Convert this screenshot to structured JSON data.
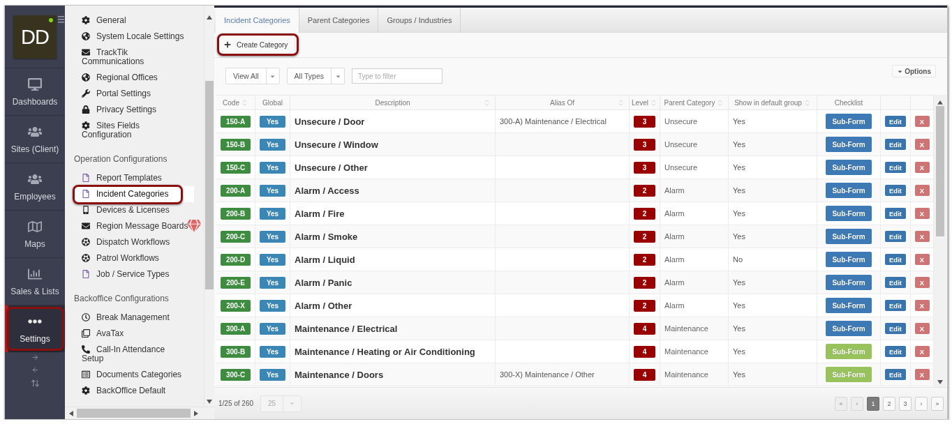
{
  "sidebar": {
    "avatar": {
      "initials": "DD",
      "online": true
    },
    "items": [
      {
        "label": "Dashboards",
        "selected": false,
        "highlighted": false
      },
      {
        "label": "Sites (Client)",
        "selected": false,
        "highlighted": false
      },
      {
        "label": "Employees",
        "selected": false,
        "highlighted": false
      },
      {
        "label": "Maps",
        "selected": false,
        "highlighted": false
      },
      {
        "label": "Sales & Lists",
        "selected": false,
        "highlighted": false
      },
      {
        "label": "Settings",
        "selected": true,
        "highlighted": true
      }
    ]
  },
  "settings_menu": {
    "sections": [
      {
        "items": [
          {
            "label": "General",
            "selected": false,
            "premium": false,
            "highlighted": false
          },
          {
            "label": "System Locale Settings",
            "selected": false,
            "premium": false,
            "highlighted": false
          },
          {
            "label": "TrackTik Communications",
            "selected": false,
            "premium": false,
            "highlighted": false
          },
          {
            "label": "Regional Offices",
            "selected": false,
            "premium": false,
            "highlighted": false
          },
          {
            "label": "Portal Settings",
            "selected": false,
            "premium": false,
            "highlighted": false
          },
          {
            "label": "Privacy Settings",
            "selected": false,
            "premium": false,
            "highlighted": false
          },
          {
            "label": "Sites Fields Configuration",
            "selected": false,
            "premium": false,
            "highlighted": false
          }
        ]
      },
      {
        "heading": "Operation Configurations",
        "items": [
          {
            "label": "Report Templates",
            "selected": false,
            "premium": false,
            "highlighted": false
          },
          {
            "label": "Incident Categories",
            "selected": true,
            "premium": false,
            "highlighted": true
          },
          {
            "label": "Devices & Licenses",
            "selected": false,
            "premium": false,
            "highlighted": false
          },
          {
            "label": "Region Message Boards",
            "selected": false,
            "premium": true,
            "highlighted": false
          },
          {
            "label": "Dispatch Workflows",
            "selected": false,
            "premium": false,
            "highlighted": false
          },
          {
            "label": "Patrol Workflows",
            "selected": false,
            "premium": false,
            "highlighted": false
          },
          {
            "label": "Job / Service Types",
            "selected": false,
            "premium": false,
            "highlighted": false
          }
        ]
      },
      {
        "heading": "Backoffice Configurations",
        "items": [
          {
            "label": "Break Management",
            "selected": false,
            "premium": false,
            "highlighted": false
          },
          {
            "label": "AvaTax",
            "selected": false,
            "premium": false,
            "highlighted": false
          },
          {
            "label": "Call-In Attendance Setup",
            "selected": false,
            "premium": false,
            "highlighted": false
          },
          {
            "label": "Documents Categories",
            "selected": false,
            "premium": false,
            "highlighted": false
          },
          {
            "label": "BackOffice Default",
            "selected": false,
            "premium": false,
            "highlighted": false
          }
        ]
      }
    ]
  },
  "tabs": [
    {
      "label": "Incident Categories",
      "selected": true
    },
    {
      "label": "Parent Categories",
      "selected": false
    },
    {
      "label": "Groups / Industries",
      "selected": false
    }
  ],
  "toolbar": {
    "create_button": {
      "label": "Create Category",
      "highlighted": true
    }
  },
  "filters": {
    "view": "View All",
    "type": "All Types",
    "search": {
      "placeholder": "Type to filter"
    },
    "options": "Options"
  },
  "table": {
    "columns": [
      {
        "label": "Code",
        "sortable": true
      },
      {
        "label": "Global",
        "sortable": false
      },
      {
        "label": "Description",
        "sortable": true
      },
      {
        "label": "Alias Of",
        "sortable": true
      },
      {
        "label": "Level",
        "sortable": true
      },
      {
        "label": "Parent Category",
        "sortable": true
      },
      {
        "label": "Show in default group",
        "sortable": true
      },
      {
        "label": "Checklist",
        "sortable": false
      }
    ],
    "rows": [
      {
        "code": "150-A",
        "global": "Yes",
        "description": "Unsecure / Door",
        "alias_of": "300-A) Maintenance / Electrical",
        "category_level": "3",
        "parent_category": "Unsecure",
        "default_group": "Yes",
        "checklist": {
          "label": "Sub-Form",
          "color": "#3d79b5"
        },
        "edit": "Edit",
        "delete": "X"
      },
      {
        "code": "150-B",
        "global": "Yes",
        "description": "Unsecure / Window",
        "category_level": "3",
        "parent_category": "Unsecure",
        "default_group": "Yes",
        "checklist": {
          "label": "Sub-Form",
          "color": "#3d79b5"
        },
        "edit": "Edit",
        "delete": "X"
      },
      {
        "code": "150-C",
        "global": "Yes",
        "description": "Unsecure / Other",
        "category_level": "3",
        "parent_category": "Unsecure",
        "default_group": "Yes",
        "checklist": {
          "label": "Sub-Form",
          "color": "#3d79b5"
        },
        "edit": "Edit",
        "delete": "X"
      },
      {
        "code": "200-A",
        "global": "Yes",
        "description": "Alarm / Access",
        "category_level": "2",
        "parent_category": "Alarm",
        "default_group": "Yes",
        "checklist": {
          "label": "Sub-Form",
          "color": "#3d79b5"
        },
        "edit": "Edit",
        "delete": "X"
      },
      {
        "code": "200-B",
        "global": "Yes",
        "description": "Alarm / Fire",
        "category_level": "2",
        "parent_category": "Alarm",
        "default_group": "Yes",
        "checklist": {
          "label": "Sub-Form",
          "color": "#3d79b5"
        },
        "edit": "Edit",
        "delete": "X"
      },
      {
        "code": "200-C",
        "global": "Yes",
        "description": "Alarm / Smoke",
        "category_level": "2",
        "parent_category": "Alarm",
        "default_group": "Yes",
        "checklist": {
          "label": "Sub-Form",
          "color": "#3d79b5"
        },
        "edit": "Edit",
        "delete": "X"
      },
      {
        "code": "200-D",
        "global": "Yes",
        "description": "Alarm / Liquid",
        "category_level": "2",
        "parent_category": "Alarm",
        "default_group": "No",
        "checklist": {
          "label": "Sub-Form",
          "color": "#3d79b5"
        },
        "edit": "Edit",
        "delete": "X"
      },
      {
        "code": "200-E",
        "global": "Yes",
        "description": "Alarm / Panic",
        "category_level": "2",
        "parent_category": "Alarm",
        "default_group": "Yes",
        "checklist": {
          "label": "Sub-Form",
          "color": "#3d79b5"
        },
        "edit": "Edit",
        "delete": "X"
      },
      {
        "code": "200-X",
        "global": "Yes",
        "description": "Alarm / Other",
        "category_level": "2",
        "parent_category": "Alarm",
        "default_group": "Yes",
        "checklist": {
          "label": "Sub-Form",
          "color": "#3d79b5"
        },
        "edit": "Edit",
        "delete": "X"
      },
      {
        "code": "300-A",
        "global": "Yes",
        "description": "Maintenance / Electrical",
        "category_level": "4",
        "parent_category": "Maintenance",
        "default_group": "Yes",
        "checklist": {
          "label": "Sub-Form",
          "color": "#3d79b5"
        },
        "edit": "Edit",
        "delete": "X"
      },
      {
        "code": "300-B",
        "global": "Yes",
        "description": "Maintenance / Heating or Air Conditioning",
        "category_level": "4",
        "parent_category": "Maintenance",
        "default_group": "Yes",
        "checklist": {
          "label": "Sub-Form",
          "color": "#97c25c"
        },
        "edit": "Edit",
        "delete": "X"
      },
      {
        "code": "300-C",
        "global": "Yes",
        "description": "Maintenance / Doors",
        "alias_of": "300-X) Maintenance / Other",
        "category_level": "4",
        "parent_category": "Maintenance",
        "default_group": "Yes",
        "checklist": {
          "label": "Sub-Form",
          "color": "#97c25c"
        },
        "edit": "Edit",
        "delete": "X"
      }
    ]
  },
  "footer": {
    "summary": "1/25 of 260",
    "page_size": {
      "value": "25",
      "disabled": true
    },
    "pages": [
      {
        "label": "«",
        "selected": false,
        "disabled": true
      },
      {
        "label": "‹",
        "selected": false,
        "disabled": true
      },
      {
        "label": "1",
        "selected": true,
        "disabled": false
      },
      {
        "label": "2",
        "selected": false,
        "disabled": false
      },
      {
        "label": "3",
        "selected": false,
        "disabled": false
      },
      {
        "label": "›",
        "selected": false,
        "disabled": false
      },
      {
        "label": "»",
        "selected": false,
        "disabled": false
      }
    ]
  }
}
